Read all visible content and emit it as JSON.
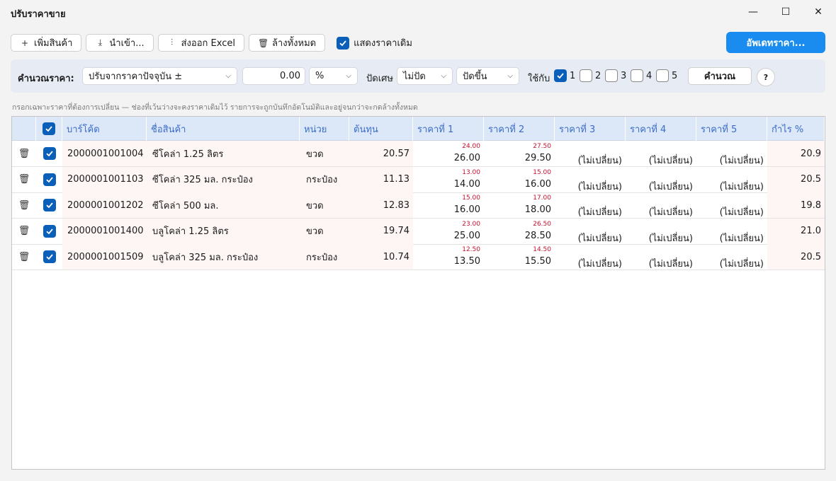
{
  "window": {
    "title": "ปรับราคาขาย"
  },
  "toolbar": {
    "add_label": "เพิ่มสินค้า",
    "import_label": "นำเข้า...",
    "export_label": "ส่งออก Excel",
    "clear_label": "ล้างทั้งหมด",
    "show_old_label": "แสดงราคาเดิม",
    "show_old_checked": true,
    "update_label": "อัพเดทราคา..."
  },
  "calc": {
    "label": "คำนวณราคา:",
    "mode": "ปรับจากราคาปัจจุบัน ±",
    "amount": "0.00",
    "unit": "%",
    "rounding_label": "ปัดเศษ",
    "rounding": "ไม่ปัด",
    "direction": "ปัดขึ้น",
    "apply_label": "ใช้กับ",
    "apply": [
      {
        "num": "1",
        "checked": true
      },
      {
        "num": "2",
        "checked": false
      },
      {
        "num": "3",
        "checked": false
      },
      {
        "num": "4",
        "checked": false
      },
      {
        "num": "5",
        "checked": false
      }
    ],
    "calc_button": "คำนวณ",
    "help": "?"
  },
  "hint": "กรอกเฉพาะราคาที่ต้องการเปลี่ยน — ช่องที่เว้นว่างจะคงราคาเดิมไว้ รายการจะถูกบันทึกอัตโนมัติและอยู่จนกว่าจะกดล้างทั้งหมด",
  "table": {
    "headers": {
      "barcode": "บาร์โค้ด",
      "name": "ชื่อสินค้า",
      "unit": "หน่วย",
      "cost": "ต้นทุน",
      "p1": "ราคาที่ 1",
      "p2": "ราคาที่ 2",
      "p3": "ราคาที่ 3",
      "p4": "ราคาที่ 4",
      "p5": "ราคาที่ 5",
      "margin": "กำไร %"
    },
    "unchanged": "(ไม่เปลี่ยน)",
    "rows": [
      {
        "checked": true,
        "barcode": "2000001001004",
        "name": "ซีโคล่า 1.25 ลิตร",
        "unit": "ขวด",
        "cost": "20.57",
        "p1_old": "24.00",
        "p1": "26.00",
        "p2_old": "27.50",
        "p2": "29.50",
        "margin": "20.9"
      },
      {
        "checked": true,
        "barcode": "2000001001103",
        "name": "ซีโคล่า 325 มล. กระป๋อง",
        "unit": "กระป๋อง",
        "cost": "11.13",
        "p1_old": "13.00",
        "p1": "14.00",
        "p2_old": "15.00",
        "p2": "16.00",
        "margin": "20.5"
      },
      {
        "checked": true,
        "barcode": "2000001001202",
        "name": "ซีโคล่า 500 มล.",
        "unit": "ขวด",
        "cost": "12.83",
        "p1_old": "15.00",
        "p1": "16.00",
        "p2_old": "17.00",
        "p2": "18.00",
        "margin": "19.8"
      },
      {
        "checked": true,
        "barcode": "2000001001400",
        "name": "บลูโคล่า 1.25 ลิตร",
        "unit": "ขวด",
        "cost": "19.74",
        "p1_old": "23.00",
        "p1": "25.00",
        "p2_old": "26.50",
        "p2": "28.50",
        "margin": "21.0"
      },
      {
        "checked": true,
        "barcode": "2000001001509",
        "name": "บลูโคล่า 325 มล. กระป๋อง",
        "unit": "กระป๋อง",
        "cost": "10.74",
        "p1_old": "12.50",
        "p1": "13.50",
        "p2_old": "14.50",
        "p2": "15.50",
        "margin": "20.5"
      }
    ]
  },
  "colors": {
    "accent": "#1a8cef",
    "checkbox": "#0a5fb8",
    "old_price": "#c8102e",
    "header_bg": "#dce7f8",
    "header_text": "#3a6dc8"
  }
}
